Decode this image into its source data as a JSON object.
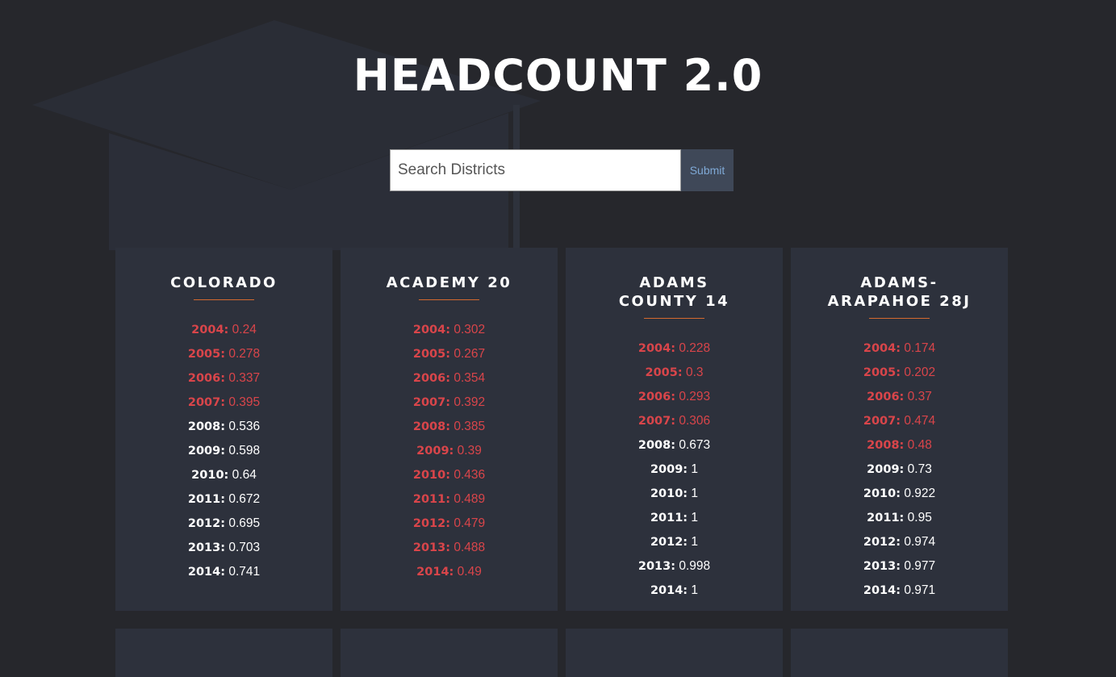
{
  "header": {
    "title": "HEADCOUNT 2.0"
  },
  "search": {
    "placeholder": "Search Districts",
    "submit_label": "Submit"
  },
  "colors": {
    "background": "#26272c",
    "card": "#2d313c",
    "low_value": "#d9454a",
    "normal_value": "#ffffff",
    "accent_underline": "#d4692f"
  },
  "districts": [
    {
      "name": "COLORADO",
      "rows": [
        {
          "year": "2004:",
          "value": "0.24",
          "low": true
        },
        {
          "year": "2005:",
          "value": "0.278",
          "low": true
        },
        {
          "year": "2006:",
          "value": "0.337",
          "low": true
        },
        {
          "year": "2007:",
          "value": "0.395",
          "low": true
        },
        {
          "year": "2008:",
          "value": "0.536",
          "low": false
        },
        {
          "year": "2009:",
          "value": "0.598",
          "low": false
        },
        {
          "year": "2010:",
          "value": "0.64",
          "low": false
        },
        {
          "year": "2011:",
          "value": "0.672",
          "low": false
        },
        {
          "year": "2012:",
          "value": "0.695",
          "low": false
        },
        {
          "year": "2013:",
          "value": "0.703",
          "low": false
        },
        {
          "year": "2014:",
          "value": "0.741",
          "low": false
        }
      ]
    },
    {
      "name": "ACADEMY 20",
      "rows": [
        {
          "year": "2004:",
          "value": "0.302",
          "low": true
        },
        {
          "year": "2005:",
          "value": "0.267",
          "low": true
        },
        {
          "year": "2006:",
          "value": "0.354",
          "low": true
        },
        {
          "year": "2007:",
          "value": "0.392",
          "low": true
        },
        {
          "year": "2008:",
          "value": "0.385",
          "low": true
        },
        {
          "year": "2009:",
          "value": "0.39",
          "low": true
        },
        {
          "year": "2010:",
          "value": "0.436",
          "low": true
        },
        {
          "year": "2011:",
          "value": "0.489",
          "low": true
        },
        {
          "year": "2012:",
          "value": "0.479",
          "low": true
        },
        {
          "year": "2013:",
          "value": "0.488",
          "low": true
        },
        {
          "year": "2014:",
          "value": "0.49",
          "low": true
        }
      ]
    },
    {
      "name": "ADAMS COUNTY 14",
      "rows": [
        {
          "year": "2004:",
          "value": "0.228",
          "low": true
        },
        {
          "year": "2005:",
          "value": "0.3",
          "low": true
        },
        {
          "year": "2006:",
          "value": "0.293",
          "low": true
        },
        {
          "year": "2007:",
          "value": "0.306",
          "low": true
        },
        {
          "year": "2008:",
          "value": "0.673",
          "low": false
        },
        {
          "year": "2009:",
          "value": "1",
          "low": false
        },
        {
          "year": "2010:",
          "value": "1",
          "low": false
        },
        {
          "year": "2011:",
          "value": "1",
          "low": false
        },
        {
          "year": "2012:",
          "value": "1",
          "low": false
        },
        {
          "year": "2013:",
          "value": "0.998",
          "low": false
        },
        {
          "year": "2014:",
          "value": "1",
          "low": false
        }
      ]
    },
    {
      "name": "ADAMS-ARAPAHOE 28J",
      "rows": [
        {
          "year": "2004:",
          "value": "0.174",
          "low": true
        },
        {
          "year": "2005:",
          "value": "0.202",
          "low": true
        },
        {
          "year": "2006:",
          "value": "0.37",
          "low": true
        },
        {
          "year": "2007:",
          "value": "0.474",
          "low": true
        },
        {
          "year": "2008:",
          "value": "0.48",
          "low": true
        },
        {
          "year": "2009:",
          "value": "0.73",
          "low": false
        },
        {
          "year": "2010:",
          "value": "0.922",
          "low": false
        },
        {
          "year": "2011:",
          "value": "0.95",
          "low": false
        },
        {
          "year": "2012:",
          "value": "0.974",
          "low": false
        },
        {
          "year": "2013:",
          "value": "0.977",
          "low": false
        },
        {
          "year": "2014:",
          "value": "0.971",
          "low": false
        }
      ]
    }
  ]
}
